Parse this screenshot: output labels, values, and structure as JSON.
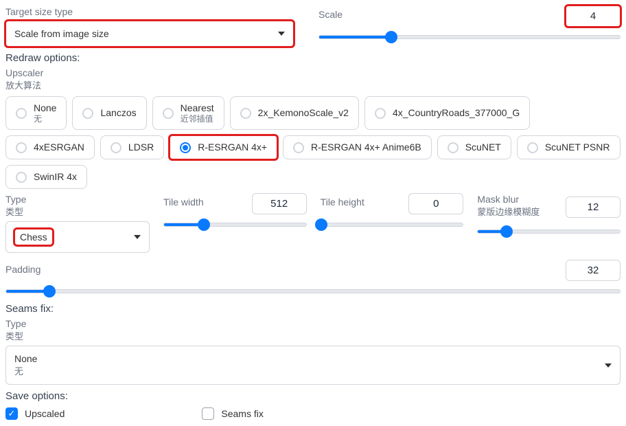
{
  "targetSize": {
    "label": "Target size type",
    "value": "Scale from image size"
  },
  "scale": {
    "label": "Scale",
    "value": "4",
    "percent": 24
  },
  "redraw": {
    "title": "Redraw options:"
  },
  "upscaler": {
    "label": "Upscaler",
    "label_cn": "放大算法",
    "options": [
      {
        "label": "None",
        "cn": "无"
      },
      {
        "label": "Lanczos"
      },
      {
        "label": "Nearest",
        "cn": "近邻插值"
      },
      {
        "label": "2x_KemonoScale_v2"
      },
      {
        "label": "4x_CountryRoads_377000_G"
      },
      {
        "label": "4xESRGAN"
      },
      {
        "label": "LDSR"
      },
      {
        "label": "R-ESRGAN 4x+",
        "selected": true,
        "highlight": true
      },
      {
        "label": "R-ESRGAN 4x+ Anime6B"
      },
      {
        "label": "ScuNET"
      },
      {
        "label": "ScuNET PSNR"
      },
      {
        "label": "SwinIR 4x"
      }
    ]
  },
  "type": {
    "label": "Type",
    "label_cn": "类型",
    "value": "Chess"
  },
  "tileWidth": {
    "label": "Tile width",
    "value": "512",
    "percent": 28
  },
  "tileHeight": {
    "label": "Tile height",
    "value": "0",
    "percent": 0
  },
  "maskBlur": {
    "label": "Mask blur",
    "label_cn": "蒙版边缘模糊度",
    "value": "12",
    "percent": 20
  },
  "padding": {
    "label": "Padding",
    "value": "32",
    "percent": 7
  },
  "seamsFix": {
    "title": "Seams fix:",
    "typeLabel": "Type",
    "typeLabel_cn": "类型",
    "value": "None",
    "value_cn": "无"
  },
  "save": {
    "title": "Save options:",
    "upscaled": {
      "label": "Upscaled",
      "checked": true
    },
    "seamsfix": {
      "label": "Seams fix",
      "checked": false
    }
  }
}
